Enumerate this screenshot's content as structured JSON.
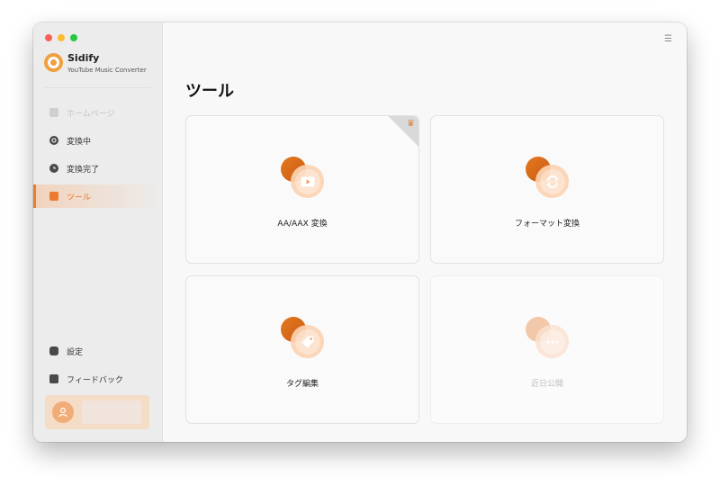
{
  "app": {
    "name": "Sidify",
    "subtitle": "YouTube Music Converter"
  },
  "sidebar": {
    "items": [
      {
        "label": "ホームページ",
        "icon": "home-icon",
        "state": "disabled"
      },
      {
        "label": "変換中",
        "icon": "converting-icon",
        "state": "normal"
      },
      {
        "label": "変換完了",
        "icon": "clock-icon",
        "state": "normal"
      },
      {
        "label": "ツール",
        "icon": "toolbox-icon",
        "state": "active"
      }
    ],
    "bottom_items": [
      {
        "label": "設定",
        "icon": "gear-icon"
      },
      {
        "label": "フィードバック",
        "icon": "mail-icon"
      }
    ]
  },
  "main": {
    "title": "ツール",
    "cards": [
      {
        "label": "AA/AAX 変換",
        "icon": "video-play-icon",
        "premium": true,
        "enabled": true
      },
      {
        "label": "フォーマット変換",
        "icon": "refresh-icon",
        "premium": false,
        "enabled": true
      },
      {
        "label": "タグ編集",
        "icon": "tag-icon",
        "premium": false,
        "enabled": true
      },
      {
        "label": "近日公開",
        "icon": "more-icon",
        "premium": false,
        "enabled": false
      }
    ]
  },
  "colors": {
    "accent": "#ec7a2f",
    "sidebar_bg": "#ececec",
    "main_bg": "#f8f8f8"
  }
}
